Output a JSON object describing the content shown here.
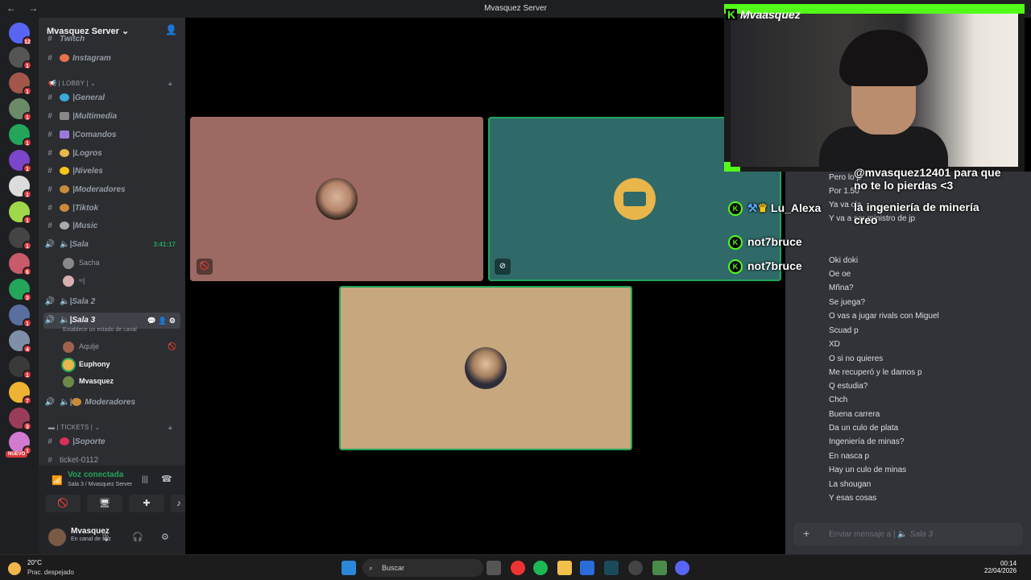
{
  "window": {
    "title": "Mvasquez Server",
    "nav": "← →"
  },
  "server": {
    "name": "Mvasquez Server",
    "invite_icon": "add-user-icon"
  },
  "server_list": {
    "badges": [
      "12",
      "1",
      "1",
      "1",
      "1",
      "1",
      "1",
      "1",
      "1",
      "6",
      "3",
      "1",
      "4",
      "1",
      "7",
      "3",
      "1"
    ],
    "new_label": "NUEVO"
  },
  "channels": {
    "top_partial": "Twitch",
    "instagram": "Instagram",
    "cat_lobby": "LOBBY",
    "general": "General",
    "multimedia": "Multimedia",
    "comandos": "Comandos",
    "logros": "Logros",
    "niveles": "Niveles",
    "moderadores": "Moderadores",
    "tiktok": "Tiktok",
    "music": "Music",
    "sala": "Sala",
    "sala_time": "3:41:17",
    "sala_users": [
      "Sacha",
      "≈|"
    ],
    "sala2": "Sala 2",
    "sala3": "Sala 3",
    "sala3_status": "Establece un estado de canal",
    "sala3_users": [
      "Aqulje",
      "Euphony",
      "Mvasquez"
    ],
    "moderadores_voice": "Moderadores",
    "cat_tickets": "TICKETS",
    "soporte": "Soporte",
    "ticket": "ticket-0112"
  },
  "voice_panel": {
    "status": "Voz conectada",
    "location": "Sala 3 / Mvasquez Server"
  },
  "user_panel": {
    "name": "Mvasquez",
    "status": "En canal de voz"
  },
  "stream_overlay": {
    "streamer": "Mvaasquez",
    "users": [
      "Lu_Alexa",
      "not7bruce",
      "not7bruce"
    ],
    "big_text": [
      "@mvasquez12401 para que",
      "no te lo pierdas <3",
      "la ingeniería de minería",
      "creo"
    ]
  },
  "chat": {
    "messages": [
      "Pero lo p",
      "Por 1.50",
      "Ya va cla",
      "Y va a ser ministro de jp",
      "Oki doki",
      "Oe oe",
      "Mñna?",
      "Se juega?",
      "O vas a jugar rivals con Miguel",
      "Scuad p",
      "XD",
      "O si no quieres",
      "Me recuperó y le damos p",
      "Q estudia?",
      "Chch",
      "Buena carrera",
      "Da un culo de plata",
      "Ingeniería de minas?",
      "En nasca p",
      "Hay un culo de minas",
      "La shougan",
      "Y esas cosas"
    ],
    "input_placeholder": "Enviar mensaje a",
    "input_channel": "Sala 3"
  },
  "taskbar": {
    "temp": "20°C",
    "weather": "Prac. despejado",
    "search": "Buscar",
    "time": "00:14",
    "date": "22/04/2026"
  },
  "colors": {
    "tile1": "#9c6a62",
    "tile2": "#2f6a68",
    "tile3": "#c7a87e",
    "speaking": "#23a55a",
    "kick": "#53fc18"
  }
}
